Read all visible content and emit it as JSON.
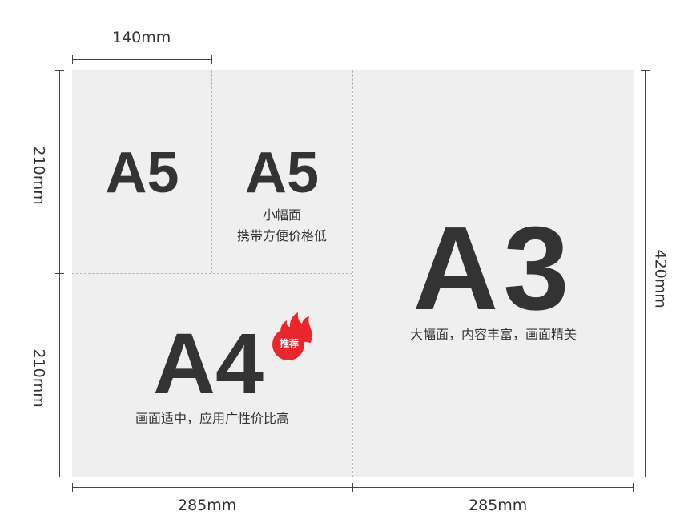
{
  "dimensions": {
    "top_width": "140mm",
    "left_upper_height": "210mm",
    "left_lower_height": "210mm",
    "right_height": "420mm",
    "bottom_left_width": "285mm",
    "bottom_right_width": "285mm"
  },
  "sections": {
    "a5_left": {
      "label": "A5"
    },
    "a5_right": {
      "label": "A5",
      "caption_line1": "小幅面",
      "caption_line2": "携带方便价格低"
    },
    "a4": {
      "label": "A4",
      "caption": "画面适中，应用广性价比高",
      "badge": "推荐"
    },
    "a3": {
      "label": "A3",
      "caption": "大幅面，内容丰富，画面精美"
    }
  },
  "colors": {
    "panel": "#efefef",
    "text": "#333333",
    "badge": "#e8262c"
  }
}
